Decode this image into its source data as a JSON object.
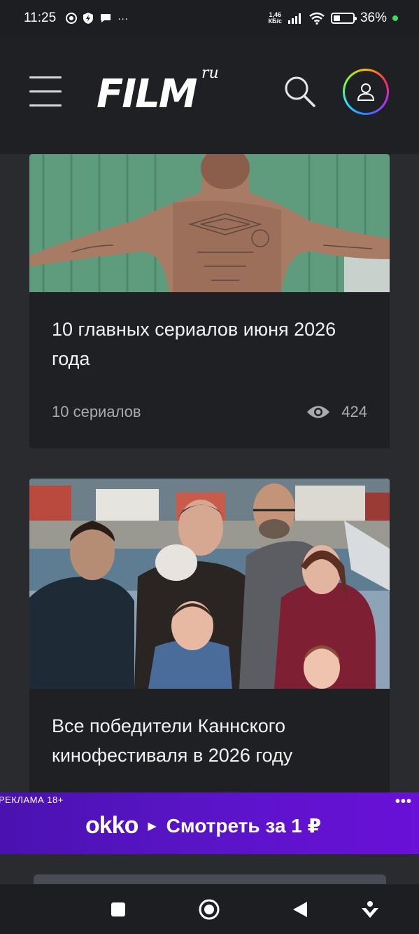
{
  "status_bar": {
    "time": "11:25",
    "speed_value": "1,46",
    "speed_unit": "КБ/с",
    "battery": "36%",
    "battery_level": 0.36,
    "left_icons": [
      "chrome-icon",
      "shield-bolt-icon",
      "chat-icon",
      "more-dots-icon"
    ],
    "more": "···"
  },
  "header": {
    "logo_main": "FILM",
    "logo_sup": "ru"
  },
  "cards": [
    {
      "title": "10 главных сериалов июня 2026 года",
      "subtitle": "10 сериалов",
      "views": "424"
    },
    {
      "title": "Все победители Каннского кинофестиваля в 2026 году"
    }
  ],
  "ad": {
    "label": "РЕКЛАМА  18+",
    "brand": "okko",
    "cta": "Смотреть за 1 ₽",
    "dots": "•••",
    "colors": {
      "background": "#5a14c8"
    }
  },
  "colors": {
    "page_bg": "#2a2b2f",
    "card_bg": "#1f2023",
    "header_bg": "#1f2023",
    "meta_text": "#a9aaad"
  }
}
